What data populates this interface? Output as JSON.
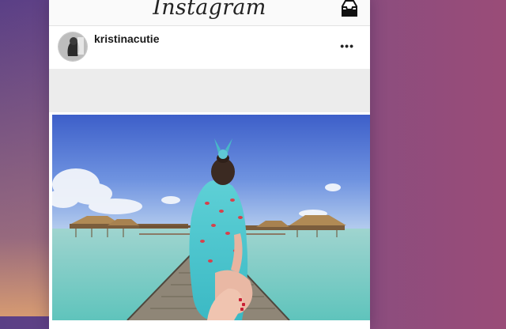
{
  "app": {
    "title": "Instagram"
  },
  "topbar": {
    "inbox_icon": "inbox-icon"
  },
  "post": {
    "username": "kristinacutie",
    "more_icon": "more-horizontal-icon",
    "more_glyph": "•••"
  },
  "colors": {
    "background_left": "#5a3f86",
    "background_right": "#9a4c78",
    "card": "#ffffff",
    "text": "#1a1a1a"
  }
}
